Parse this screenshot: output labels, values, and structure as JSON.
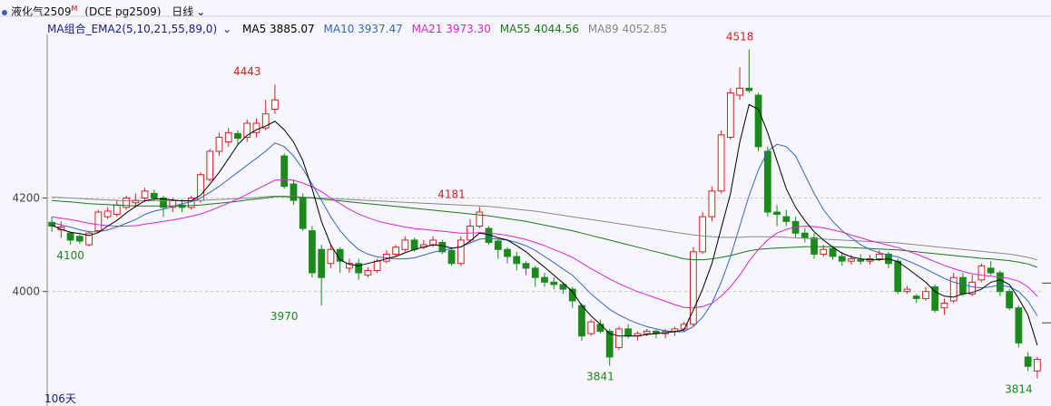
{
  "header": {
    "symbol_name": "液化气2509",
    "symbol_mark": "M",
    "exchange_code": "(DCE pg2509)",
    "period": "日线"
  },
  "legend": {
    "group_label": "MA组合_EMA2(5,10,21,55,89,0)",
    "ma5": "MA5 3885.07",
    "ma10": "MA10 3937.47",
    "ma21": "MA21 3973.30",
    "ma55": "MA55 4044.56",
    "ma89": "MA89 4052.85"
  },
  "colors": {
    "up": "#d62020",
    "down": "#1a8a1a",
    "ma5": "#000000",
    "ma10": "#3366cc",
    "ma21": "#dd22dd",
    "ma55": "#1a7a1a",
    "ma89": "#888888",
    "grid": "#c8c8c8",
    "axis": "#444444"
  },
  "chart_data": {
    "type": "candlestick",
    "ylim": [
      3790,
      4550
    ],
    "y_ticks": [
      4000,
      4200
    ],
    "bottom_label": "106天",
    "annotations": [
      {
        "text": "4443",
        "index": 21,
        "value": 4443,
        "kind": "high"
      },
      {
        "text": "4100",
        "index": 2,
        "value": 4100,
        "kind": "low"
      },
      {
        "text": "3970",
        "index": 25,
        "value": 3970,
        "kind": "low"
      },
      {
        "text": "4181",
        "index": 43,
        "value": 4181,
        "kind": "high"
      },
      {
        "text": "3841",
        "index": 59,
        "value": 3841,
        "kind": "low"
      },
      {
        "text": "4518",
        "index": 74,
        "value": 4518,
        "kind": "high"
      },
      {
        "text": "3814",
        "index": 104,
        "value": 3814,
        "kind": "low"
      }
    ],
    "candles": [
      [
        4148,
        4140,
        4160,
        4128
      ],
      [
        4132,
        4138,
        4150,
        4115
      ],
      [
        4125,
        4110,
        4128,
        4100
      ],
      [
        4118,
        4108,
        4122,
        4102
      ],
      [
        4100,
        4125,
        4130,
        4096
      ],
      [
        4130,
        4170,
        4175,
        4125
      ],
      [
        4160,
        4172,
        4180,
        4155
      ],
      [
        4165,
        4185,
        4195,
        4160
      ],
      [
        4180,
        4200,
        4205,
        4175
      ],
      [
        4190,
        4195,
        4210,
        4180
      ],
      [
        4200,
        4215,
        4222,
        4192
      ],
      [
        4210,
        4200,
        4218,
        4195
      ],
      [
        4200,
        4180,
        4205,
        4160
      ],
      [
        4180,
        4195,
        4200,
        4170
      ],
      [
        4185,
        4180,
        4198,
        4170
      ],
      [
        4180,
        4200,
        4205,
        4175
      ],
      [
        4195,
        4250,
        4255,
        4190
      ],
      [
        4240,
        4300,
        4305,
        4235
      ],
      [
        4300,
        4330,
        4340,
        4290
      ],
      [
        4320,
        4340,
        4350,
        4310
      ],
      [
        4338,
        4328,
        4345,
        4315
      ],
      [
        4330,
        4360,
        4368,
        4320
      ],
      [
        4340,
        4360,
        4370,
        4330
      ],
      [
        4350,
        4380,
        4410,
        4345
      ],
      [
        4390,
        4410,
        4443,
        4380
      ],
      [
        4290,
        4225,
        4295,
        4220
      ],
      [
        4230,
        4195,
        4240,
        4185
      ],
      [
        4200,
        4135,
        4210,
        4130
      ],
      [
        4130,
        4040,
        4140,
        4030
      ],
      [
        4090,
        4030,
        4100,
        3970
      ],
      [
        4060,
        4090,
        4100,
        4050
      ],
      [
        4090,
        4065,
        4095,
        4040
      ],
      [
        4050,
        4060,
        4070,
        4040
      ],
      [
        4060,
        4040,
        4070,
        4025
      ],
      [
        4035,
        4045,
        4052,
        4030
      ],
      [
        4045,
        4065,
        4070,
        4040
      ],
      [
        4065,
        4080,
        4088,
        4060
      ],
      [
        4080,
        4095,
        4100,
        4075
      ],
      [
        4090,
        4110,
        4118,
        4085
      ],
      [
        4110,
        4090,
        4115,
        4085
      ],
      [
        4095,
        4100,
        4110,
        4090
      ],
      [
        4100,
        4110,
        4118,
        4095
      ],
      [
        4105,
        4085,
        4110,
        4080
      ],
      [
        4088,
        4060,
        4095,
        4055
      ],
      [
        4060,
        4110,
        4118,
        4055
      ],
      [
        4110,
        4140,
        4155,
        4105
      ],
      [
        4140,
        4170,
        4181,
        4135
      ],
      [
        4135,
        4105,
        4140,
        4100
      ],
      [
        4108,
        4090,
        4112,
        4070
      ],
      [
        4090,
        4075,
        4095,
        4060
      ],
      [
        4075,
        4060,
        4085,
        4045
      ],
      [
        4060,
        4050,
        4065,
        4035
      ],
      [
        4050,
        4030,
        4055,
        4010
      ],
      [
        4030,
        4020,
        4040,
        4010
      ],
      [
        4020,
        4015,
        4030,
        4005
      ],
      [
        4015,
        4005,
        4020,
        3995
      ],
      [
        4005,
        3980,
        4010,
        3965
      ],
      [
        3970,
        3905,
        3975,
        3895
      ],
      [
        3910,
        3935,
        3940,
        3905
      ],
      [
        3930,
        3915,
        3940,
        3910
      ],
      [
        3915,
        3860,
        3920,
        3841
      ],
      [
        3880,
        3920,
        3925,
        3875
      ],
      [
        3920,
        3905,
        3930,
        3900
      ],
      [
        3905,
        3910,
        3915,
        3895
      ],
      [
        3910,
        3915,
        3920,
        3905
      ],
      [
        3915,
        3910,
        3920,
        3900
      ],
      [
        3910,
        3915,
        3920,
        3900
      ],
      [
        3915,
        3920,
        3925,
        3905
      ],
      [
        3920,
        3930,
        3935,
        3915
      ],
      [
        3930,
        4085,
        4095,
        3925
      ],
      [
        4085,
        4160,
        4170,
        4080
      ],
      [
        4160,
        4215,
        4225,
        4150
      ],
      [
        4215,
        4335,
        4345,
        4210
      ],
      [
        4330,
        4425,
        4435,
        4325
      ],
      [
        4420,
        4435,
        4480,
        4410
      ],
      [
        4435,
        4430,
        4518,
        4425
      ],
      [
        4420,
        4310,
        4425,
        4300
      ],
      [
        4300,
        4170,
        4310,
        4160
      ],
      [
        4170,
        4165,
        4185,
        4140
      ],
      [
        4160,
        4150,
        4175,
        4140
      ],
      [
        4150,
        4125,
        4160,
        4115
      ],
      [
        4125,
        4115,
        4135,
        4105
      ],
      [
        4115,
        4080,
        4125,
        4070
      ],
      [
        4080,
        4090,
        4100,
        4075
      ],
      [
        4092,
        4075,
        4097,
        4068
      ],
      [
        4075,
        4065,
        4085,
        4055
      ],
      [
        4065,
        4070,
        4078,
        4058
      ],
      [
        4068,
        4065,
        4080,
        4058
      ],
      [
        4065,
        4070,
        4078,
        4058
      ],
      [
        4070,
        4080,
        4088,
        4065
      ],
      [
        4080,
        4060,
        4085,
        4050
      ],
      [
        4065,
        4000,
        4070,
        3995
      ],
      [
        4000,
        4005,
        4012,
        3995
      ],
      [
        3990,
        3985,
        3995,
        3975
      ],
      [
        3985,
        4000,
        4010,
        3980
      ],
      [
        4010,
        3960,
        4015,
        3955
      ],
      [
        3965,
        3975,
        3985,
        3950
      ],
      [
        3980,
        4030,
        4040,
        3975
      ],
      [
        4030,
        3995,
        4040,
        3990
      ],
      [
        3995,
        4020,
        4035,
        3990
      ],
      [
        4025,
        4055,
        4060,
        4020
      ],
      [
        4050,
        4040,
        4065,
        4035
      ],
      [
        4040,
        4000,
        4045,
        3990
      ],
      [
        4000,
        3965,
        4005,
        3960
      ],
      [
        3965,
        3890,
        3970,
        3880
      ],
      [
        3860,
        3840,
        3870,
        3830
      ],
      [
        3830,
        3855,
        3860,
        3814
      ]
    ],
    "ma5": [
      4142,
      4133,
      4127,
      4124,
      4120,
      4126,
      4140,
      4152,
      4168,
      4182,
      4194,
      4198,
      4198,
      4196,
      4194,
      4194,
      4206,
      4230,
      4255,
      4284,
      4314,
      4334,
      4346,
      4354,
      4364,
      4346,
      4320,
      4280,
      4220,
      4150,
      4100,
      4068,
      4058,
      4055,
      4060,
      4065,
      4070,
      4075,
      4083,
      4090,
      4095,
      4100,
      4098,
      4093,
      4095,
      4108,
      4125,
      4122,
      4115,
      4110,
      4098,
      4085,
      4068,
      4052,
      4035,
      4018,
      4000,
      3970,
      3948,
      3930,
      3910,
      3905,
      3905,
      3905,
      3908,
      3910,
      3912,
      3914,
      3918,
      3960,
      4005,
      4060,
      4135,
      4210,
      4320,
      4400,
      4390,
      4340,
      4280,
      4220,
      4180,
      4152,
      4128,
      4110,
      4095,
      4082,
      4074,
      4070,
      4068,
      4068,
      4070,
      4064,
      4050,
      4035,
      4020,
      4000,
      3990,
      3988,
      3995,
      3998,
      4005,
      4020,
      4025,
      4015,
      3985,
      3950,
      3885
    ],
    "ma10": [
      4148,
      4142,
      4138,
      4132,
      4128,
      4128,
      4132,
      4138,
      4146,
      4154,
      4165,
      4172,
      4176,
      4182,
      4188,
      4192,
      4200,
      4212,
      4225,
      4240,
      4255,
      4270,
      4285,
      4300,
      4318,
      4310,
      4290,
      4262,
      4230,
      4195,
      4160,
      4130,
      4108,
      4090,
      4080,
      4074,
      4072,
      4070,
      4070,
      4072,
      4078,
      4084,
      4088,
      4092,
      4096,
      4104,
      4112,
      4114,
      4112,
      4110,
      4105,
      4098,
      4088,
      4075,
      4062,
      4048,
      4035,
      4015,
      3995,
      3978,
      3962,
      3950,
      3940,
      3932,
      3925,
      3920,
      3916,
      3914,
      3914,
      3925,
      3945,
      3975,
      4020,
      4075,
      4140,
      4205,
      4260,
      4300,
      4315,
      4310,
      4290,
      4250,
      4210,
      4175,
      4150,
      4130,
      4115,
      4100,
      4090,
      4083,
      4078,
      4074,
      4066,
      4058,
      4048,
      4038,
      4028,
      4020,
      4015,
      4010,
      4008,
      4010,
      4014,
      4010,
      4000,
      3980,
      3948
    ],
    "ma21": [
      4160,
      4157,
      4154,
      4150,
      4146,
      4143,
      4141,
      4140,
      4140,
      4141,
      4144,
      4147,
      4150,
      4153,
      4157,
      4161,
      4166,
      4173,
      4181,
      4189,
      4198,
      4208,
      4218,
      4228,
      4238,
      4240,
      4238,
      4232,
      4224,
      4214,
      4200,
      4188,
      4176,
      4166,
      4158,
      4151,
      4146,
      4142,
      4138,
      4135,
      4133,
      4131,
      4129,
      4127,
      4125,
      4125,
      4126,
      4125,
      4123,
      4120,
      4116,
      4111,
      4105,
      4098,
      4090,
      4082,
      4073,
      4061,
      4049,
      4038,
      4027,
      4017,
      4008,
      4000,
      3993,
      3986,
      3979,
      3972,
      3966,
      3965,
      3968,
      3975,
      3990,
      4010,
      4035,
      4065,
      4090,
      4110,
      4125,
      4133,
      4138,
      4140,
      4139,
      4136,
      4132,
      4127,
      4121,
      4115,
      4109,
      4104,
      4099,
      4094,
      4087,
      4080,
      4072,
      4064,
      4056,
      4049,
      4043,
      4038,
      4035,
      4033,
      4031,
      4028,
      4022,
      4010,
      3990
    ],
    "ma55": [
      4195,
      4193,
      4192,
      4190,
      4188,
      4187,
      4186,
      4185,
      4184,
      4183,
      4183,
      4183,
      4183,
      4183,
      4183,
      4184,
      4185,
      4187,
      4189,
      4191,
      4193,
      4196,
      4198,
      4200,
      4203,
      4203,
      4202,
      4201,
      4200,
      4198,
      4196,
      4194,
      4192,
      4190,
      4188,
      4186,
      4184,
      4182,
      4180,
      4178,
      4176,
      4174,
      4172,
      4170,
      4168,
      4166,
      4164,
      4162,
      4159,
      4156,
      4153,
      4150,
      4146,
      4142,
      4138,
      4134,
      4130,
      4125,
      4120,
      4115,
      4110,
      4105,
      4100,
      4095,
      4090,
      4085,
      4080,
      4075,
      4070,
      4068,
      4068,
      4070,
      4073,
      4077,
      4082,
      4087,
      4090,
      4092,
      4093,
      4094,
      4095,
      4096,
      4096,
      4096,
      4096,
      4095,
      4094,
      4093,
      4092,
      4091,
      4090,
      4089,
      4087,
      4085,
      4083,
      4081,
      4079,
      4077,
      4075,
      4073,
      4071,
      4070,
      4068,
      4066,
      4063,
      4059,
      4052
    ],
    "ma89": [
      4202,
      4201,
      4200,
      4199,
      4198,
      4197,
      4196,
      4195,
      4194,
      4194,
      4194,
      4194,
      4194,
      4194,
      4194,
      4194,
      4195,
      4196,
      4197,
      4198,
      4199,
      4200,
      4201,
      4203,
      4204,
      4204,
      4203,
      4202,
      4201,
      4200,
      4199,
      4198,
      4197,
      4196,
      4195,
      4194,
      4193,
      4192,
      4191,
      4190,
      4189,
      4188,
      4187,
      4186,
      4185,
      4184,
      4183,
      4182,
      4180,
      4178,
      4176,
      4174,
      4172,
      4169,
      4166,
      4163,
      4160,
      4157,
      4154,
      4151,
      4148,
      4145,
      4142,
      4139,
      4136,
      4133,
      4130,
      4127,
      4124,
      4121,
      4119,
      4117,
      4116,
      4116,
      4116,
      4117,
      4117,
      4117,
      4117,
      4116,
      4115,
      4114,
      4113,
      4112,
      4111,
      4110,
      4109,
      4108,
      4107,
      4106,
      4105,
      4104,
      4102,
      4100,
      4098,
      4096,
      4094,
      4092,
      4090,
      4088,
      4086,
      4084,
      4082,
      4080,
      4077,
      4073,
      4068
    ]
  }
}
